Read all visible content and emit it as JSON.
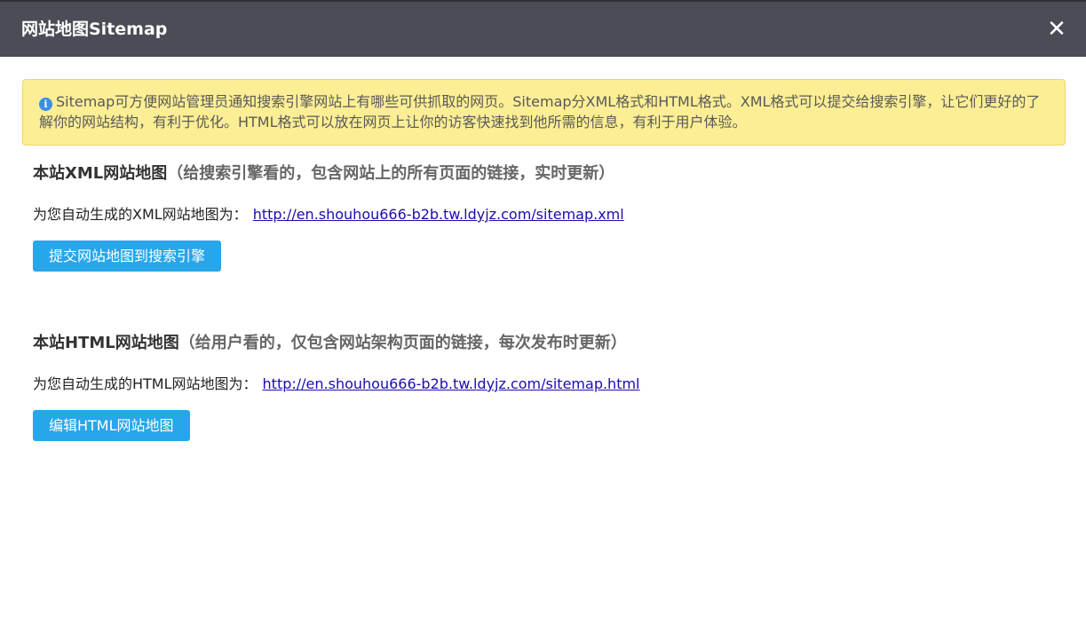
{
  "dialog": {
    "title": "网站地图Sitemap",
    "close_symbol": "✕"
  },
  "notice": {
    "icon": "info-icon",
    "icon_glyph": "i",
    "text": "Sitemap可方便网站管理员通知搜索引擎网站上有哪些可供抓取的网页。Sitemap分XML格式和HTML格式。XML格式可以提交给搜索引擎，让它们更好的了解你的网站结构，有利于优化。HTML格式可以放在网页上让你的访客快速找到他所需的信息，有利于用户体验。"
  },
  "xml_section": {
    "heading": "本站XML网站地图",
    "heading_note": "（给搜索引擎看的，包含网站上的所有页面的链接，实时更新）",
    "label": "为您自动生成的XML网站地图为：",
    "url": "http://en.shouhou666-b2b.tw.ldyjz.com/sitemap.xml",
    "button_label": "提交网站地图到搜索引擎"
  },
  "html_section": {
    "heading": "本站HTML网站地图",
    "heading_note": "（给用户看的，仅包含网站架构页面的链接，每次发布时更新）",
    "label": "为您自动生成的HTML网站地图为：",
    "url": "http://en.shouhou666-b2b.tw.ldyjz.com/sitemap.html",
    "button_label": "编辑HTML网站地图"
  },
  "colors": {
    "titlebar": "#4a4d55",
    "notice_bg": "#fcee94",
    "button": "#27a6ea",
    "link": "#1a0dab"
  }
}
